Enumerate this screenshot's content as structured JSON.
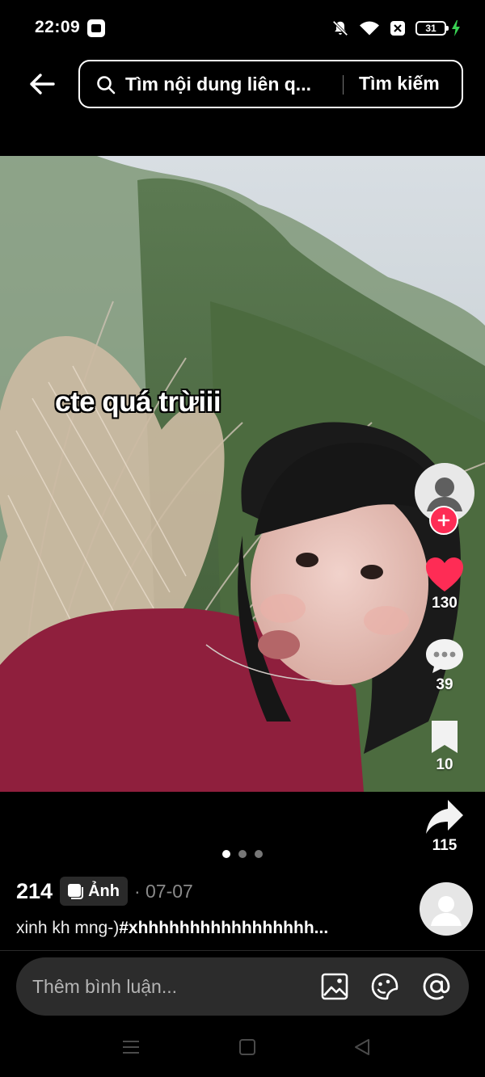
{
  "status_bar": {
    "time": "22:09",
    "battery": "31"
  },
  "header": {
    "search_placeholder": "Tìm nội dung liên q...",
    "search_button": "Tìm kiếm"
  },
  "post": {
    "overlay_text": "cte quá trừiii",
    "page_count": 3,
    "active_page": 1,
    "views": "214",
    "type_badge": "Ảnh",
    "date": "· 07-07",
    "caption_text": "xinh kh mng-)",
    "caption_hashtag": "#xhhhhhhhhhhhhhhhhh..."
  },
  "actions": {
    "likes": "130",
    "comments": "39",
    "saves": "10",
    "shares": "115"
  },
  "comment_bar": {
    "placeholder": "Thêm bình luận..."
  },
  "colors": {
    "like": "#fe2c55",
    "follow": "#fe2c55",
    "background": "#000000"
  }
}
